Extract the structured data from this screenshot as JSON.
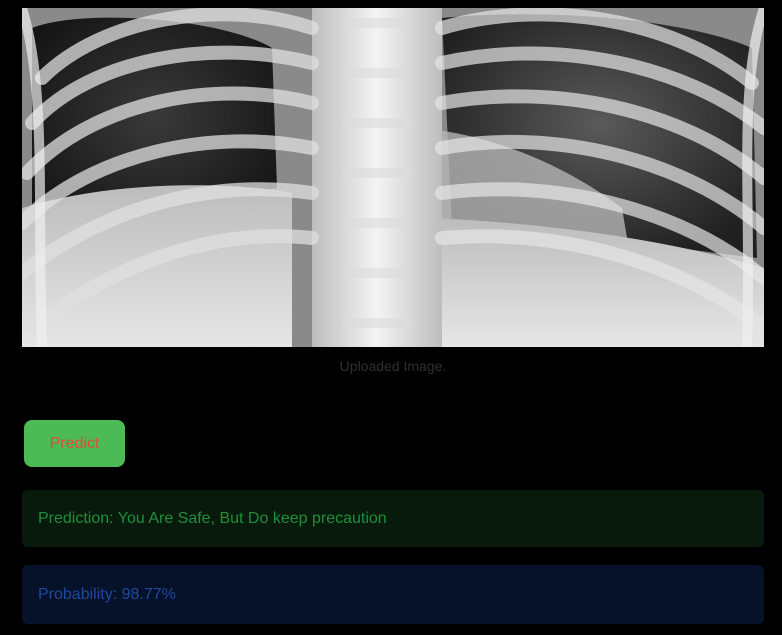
{
  "image": {
    "caption": "Uploaded Image."
  },
  "actions": {
    "predict_label": "Predict"
  },
  "results": {
    "prediction": "Prediction: You Are Safe, But Do keep precaution",
    "probability": "Probability: 98.77%"
  },
  "colors": {
    "background": "#000000",
    "button_bg": "#4cbb55",
    "button_text": "#e8483a",
    "success_bg": "#071a0c",
    "success_text": "#1f8f3a",
    "info_bg": "#06122a",
    "info_text": "#1d4a9c"
  }
}
